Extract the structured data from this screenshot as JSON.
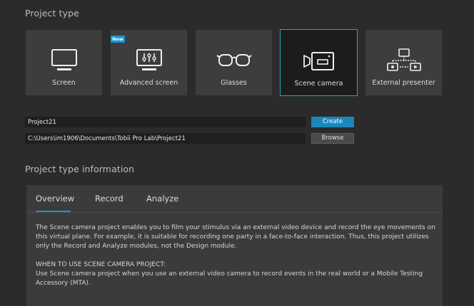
{
  "project_type": {
    "heading": "Project type",
    "new_badge": "New",
    "cards": [
      {
        "label": "Screen",
        "icon": "monitor-icon",
        "selected": false
      },
      {
        "label": "Advanced screen",
        "icon": "advanced-screen-icon",
        "selected": false
      },
      {
        "label": "Glasses",
        "icon": "glasses-icon",
        "selected": false
      },
      {
        "label": "Scene camera",
        "icon": "scene-camera-icon",
        "selected": true
      },
      {
        "label": "External presenter",
        "icon": "external-presenter-icon",
        "selected": false
      }
    ]
  },
  "form": {
    "project_name": "Project21",
    "project_path": "C:\\Users\\im1906\\Documents\\Tobii Pro Lab\\Project21",
    "create_label": "Create",
    "browse_label": "Browse"
  },
  "info": {
    "heading": "Project type information",
    "tabs": [
      {
        "label": "Overview",
        "active": true
      },
      {
        "label": "Record",
        "active": false
      },
      {
        "label": "Analyze",
        "active": false
      }
    ],
    "description": "The Scene camera project enables you to film your stimulus via an external video device and record the eye movements on this virtual plane. For example, it is suitable for recording one party in a face-to-face interaction. Thus, this project utilizes only the Record and Analyze modules, not the Design module.",
    "when_heading": "WHEN TO USE SCENE CAMERA PROJECT:",
    "when_text": "Use Scene camera project when you use an external video camera to record events in the real world or a Mobile Testing Accessory (MTA)."
  },
  "colors": {
    "accent": "#1a95d0",
    "selected_border": "#22a3d3",
    "background": "#2b2b2b",
    "card": "#3d3d3d"
  }
}
